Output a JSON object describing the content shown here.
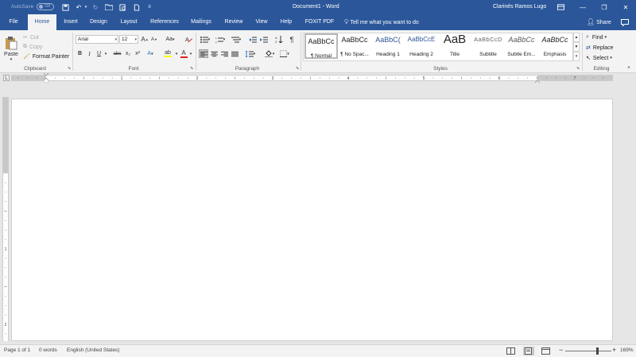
{
  "title_bar": {
    "autosave_label": "AutoSave",
    "autosave_state": "Off",
    "document_title": "Document1 - Word",
    "user_name": "Clarinés Ramos Lugo",
    "minimize_glyph": "—",
    "restore_glyph": "❐",
    "close_glyph": "✕"
  },
  "tabs": [
    {
      "label": "File"
    },
    {
      "label": "Home",
      "active": true
    },
    {
      "label": "Insert"
    },
    {
      "label": "Design"
    },
    {
      "label": "Layout"
    },
    {
      "label": "References"
    },
    {
      "label": "Mailings"
    },
    {
      "label": "Review"
    },
    {
      "label": "View"
    },
    {
      "label": "Help"
    },
    {
      "label": "FOXIT PDF"
    }
  ],
  "tell_me": "Tell me what you want to do",
  "share_label": "Share",
  "clipboard": {
    "paste": "Paste",
    "cut": "Cut",
    "copy": "Copy",
    "format_painter": "Format Painter",
    "group": "Clipboard"
  },
  "font": {
    "family": "Arial",
    "size": "12",
    "group": "Font",
    "bold": "B",
    "italic": "I",
    "underline": "U",
    "strikethrough": "abc",
    "subscript": "x₂",
    "superscript": "x²",
    "grow": "A",
    "shrink": "A",
    "change_case": "Aa",
    "text_effects": "A",
    "font_color": "A",
    "highlight_color": "#ffff00",
    "font_color_value": "#e02020"
  },
  "paragraph": {
    "group": "Paragraph",
    "pilcrow": "¶"
  },
  "styles": {
    "group": "Styles",
    "items": [
      {
        "sample": "AaBbCc",
        "name": "¶ Normal"
      },
      {
        "sample": "AaBbCc",
        "name": "¶ No Spac..."
      },
      {
        "sample": "AaBbC(",
        "name": "Heading 1"
      },
      {
        "sample": "AaBbCcE",
        "name": "Heading 2"
      },
      {
        "sample": "AaB",
        "name": "Title"
      },
      {
        "sample": "AaBbCcD",
        "name": "Subtitle"
      },
      {
        "sample": "AaBbCc",
        "name": "Subtle Em..."
      },
      {
        "sample": "AaBbCc",
        "name": "Emphasis"
      }
    ]
  },
  "editing": {
    "find": "Find",
    "replace": "Replace",
    "select": "Select",
    "group": "Editing"
  },
  "ruler_numbers": [
    "1",
    "2",
    "3",
    "4",
    "5",
    "6",
    "7"
  ],
  "ruler_v_numbers": [
    "1",
    "2"
  ],
  "status": {
    "page": "Page 1 of 1",
    "words": "0 words",
    "language": "English (United States)",
    "zoom": "169%",
    "zoom_minus": "−",
    "zoom_plus": "+",
    "zoom_fraction": 0.69
  },
  "colors": {
    "accent": "#2b579a"
  }
}
